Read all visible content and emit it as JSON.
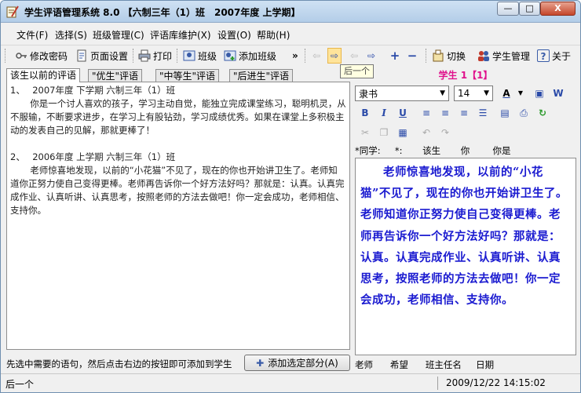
{
  "window": {
    "title": "学生评语管理系统 8.0 【六制三年（1）班　2007年度 上学期】",
    "min_label": "—",
    "max_label": "□",
    "close_label": "X"
  },
  "menu": [
    "文件(F)",
    "选择(S)",
    "班级管理(C)",
    "评语库维护(X)",
    "设置(O)",
    "帮助(H)"
  ],
  "toolbar": {
    "change_password": "修改密码",
    "page_setup": "页面设置",
    "print": "打印",
    "class": "班级",
    "add_class": "添加班级",
    "more": "»",
    "switch": "切换",
    "student_mgmt": "学生管理",
    "about": "关于"
  },
  "tooltip": "后一个",
  "left": {
    "tabs": [
      "该生以前的评语",
      "\"优生\"评语",
      "\"中等生\"评语",
      "\"后进生\"评语"
    ],
    "entries": [
      {
        "head": "1、　 2007年度 下学期 六制三年（1）班",
        "body": "你是一个讨人喜欢的孩子，学习主动自觉，能独立完成课堂练习，聪明机灵，从不服输，不断要求进步，在学习上有股钻劲，学习成绩优秀。如果在课堂上多积极主动的发表自己的见解，那就更棒了！"
      },
      {
        "head": "2、　 2006年度 上学期 六制三年（1）班",
        "body": "老师惊喜地发现，以前的“小花猫”不见了，现在的你也开始讲卫生了。老师知道你正努力使自己变得更棒。老师再告诉你一个好方法好吗？那就是：认真。认真完成作业、认真听讲、认真思考，按照老师的方法去做吧！你一定会成功，老师相信、支持你。"
      }
    ],
    "hint": "先选中需要的语句，然后点击右边的按钮即可添加到学生",
    "add_button": "添加选定部分(A)"
  },
  "right": {
    "student_title": "学生 1【1】",
    "font_name": "隶书",
    "font_size": "14",
    "ruler": "*同学:     *:       该生       你        你是",
    "comment": "老师惊喜地发现，以前的“小花猫”不见了，现在的你也开始讲卫生了。老师知道你正努力使自己变得更棒。老师再告诉你一个好方法好吗？那就是：认真。认真完成作业、认真听讲、认真思考，按照老师的方法去做吧！你一定会成功，老师相信、支持你。",
    "footer": "老师      希望      班主任名     日期"
  },
  "status": {
    "left": "后一个",
    "datetime": "2009/12/22 14:15:02"
  },
  "colors": {
    "student_title": "#e0118c",
    "editor_text": "#1a1ad0",
    "active_button": "#ffe49a"
  }
}
